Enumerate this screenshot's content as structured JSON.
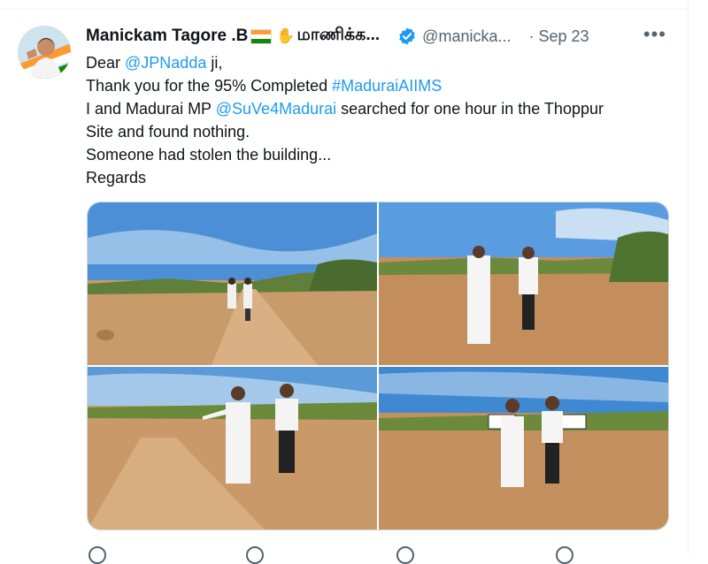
{
  "tweet": {
    "author_name": "Manickam Tagore .B",
    "author_name_tamil": "மாணிக்க...",
    "handle": "@manicka...",
    "separator": "·",
    "date": "Sep 23",
    "more_label": "•••",
    "lines": [
      {
        "pre": "Dear ",
        "link": "@JPNadda",
        "post": " ji,"
      },
      {
        "pre": "Thank you for the 95% Completed ",
        "link": "#MaduraiAIIMS",
        "post": ""
      },
      {
        "pre": "I and Madurai MP ",
        "link": "@SuVe4Madurai",
        "post": " searched for one hour in the Thoppur"
      },
      {
        "pre": "Site and found nothing.",
        "link": "",
        "post": ""
      },
      {
        "pre": "Someone had stolen the building...",
        "link": "",
        "post": ""
      },
      {
        "pre": "Regards",
        "link": "",
        "post": ""
      }
    ]
  },
  "colors": {
    "link": "#1d9bf0",
    "muted": "#536471",
    "verified": "#1d9bf0",
    "flag_saffron": "#ff9933",
    "flag_green": "#138808"
  },
  "icons": {
    "verified": "verified-badge-icon",
    "more": "more-icon",
    "hand": "raised-hand-emoji",
    "flag": "india-flag-emoji"
  }
}
